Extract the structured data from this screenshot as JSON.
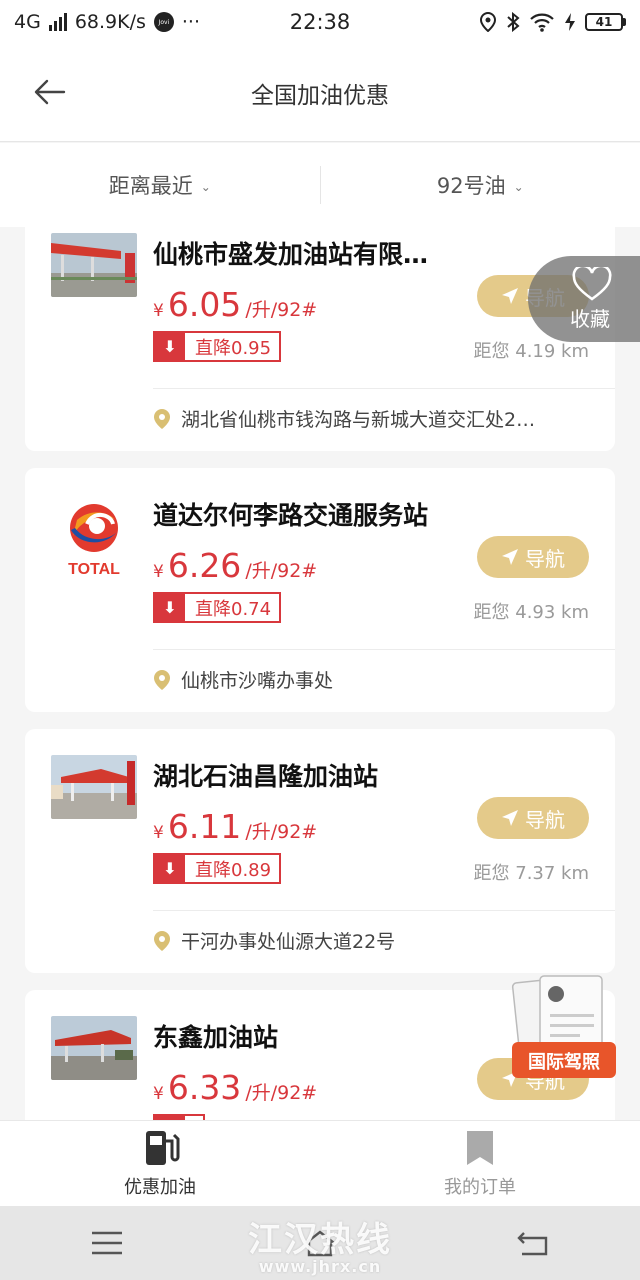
{
  "status_bar": {
    "network": "4G",
    "speed": "68.9K/s",
    "jovi": "Jovi",
    "more": "···",
    "time": "22:38",
    "battery": "41"
  },
  "header": {
    "title": "全国加油优惠"
  },
  "filters": {
    "sort": "距离最近",
    "fuel": "92号油"
  },
  "favorite": {
    "label": "收藏"
  },
  "stations": [
    {
      "name": "仙桃市盛发加油站有限…",
      "yen": "¥",
      "price": "6.05",
      "unit": "/升/92#",
      "discount": "直降0.95",
      "nav_label": "导航",
      "distance": "距您 4.19 km",
      "address": "湖北省仙桃市钱沟路与新城大道交汇处2…"
    },
    {
      "name": "道达尔何李路交通服务站",
      "yen": "¥",
      "price": "6.26",
      "unit": "/升/92#",
      "discount": "直降0.74",
      "nav_label": "导航",
      "distance": "距您 4.93 km",
      "address": "仙桃市沙嘴办事处",
      "logo_text": "TOTAL"
    },
    {
      "name": "湖北石油昌隆加油站",
      "yen": "¥",
      "price": "6.11",
      "unit": "/升/92#",
      "discount": "直降0.89",
      "nav_label": "导航",
      "distance": "距您 7.37 km",
      "address": "干河办事处仙源大道22号"
    },
    {
      "name": "东鑫加油站",
      "yen": "¥",
      "price": "6.33",
      "unit": "/升/92#",
      "discount": "",
      "nav_label": "导航",
      "distance": "",
      "address": ""
    }
  ],
  "promo": {
    "label": "国际驾照"
  },
  "tabs": [
    {
      "label": "优惠加油",
      "icon": "fuel-pump-icon"
    },
    {
      "label": "我的订单",
      "icon": "bookmark-icon"
    }
  ],
  "watermark": {
    "title": "江汉热线",
    "url": "www.jhrx.cn"
  },
  "colors": {
    "price_red": "#d8373c",
    "nav_gold": "#e4ca8a",
    "pin_gold": "#d9bf73"
  }
}
